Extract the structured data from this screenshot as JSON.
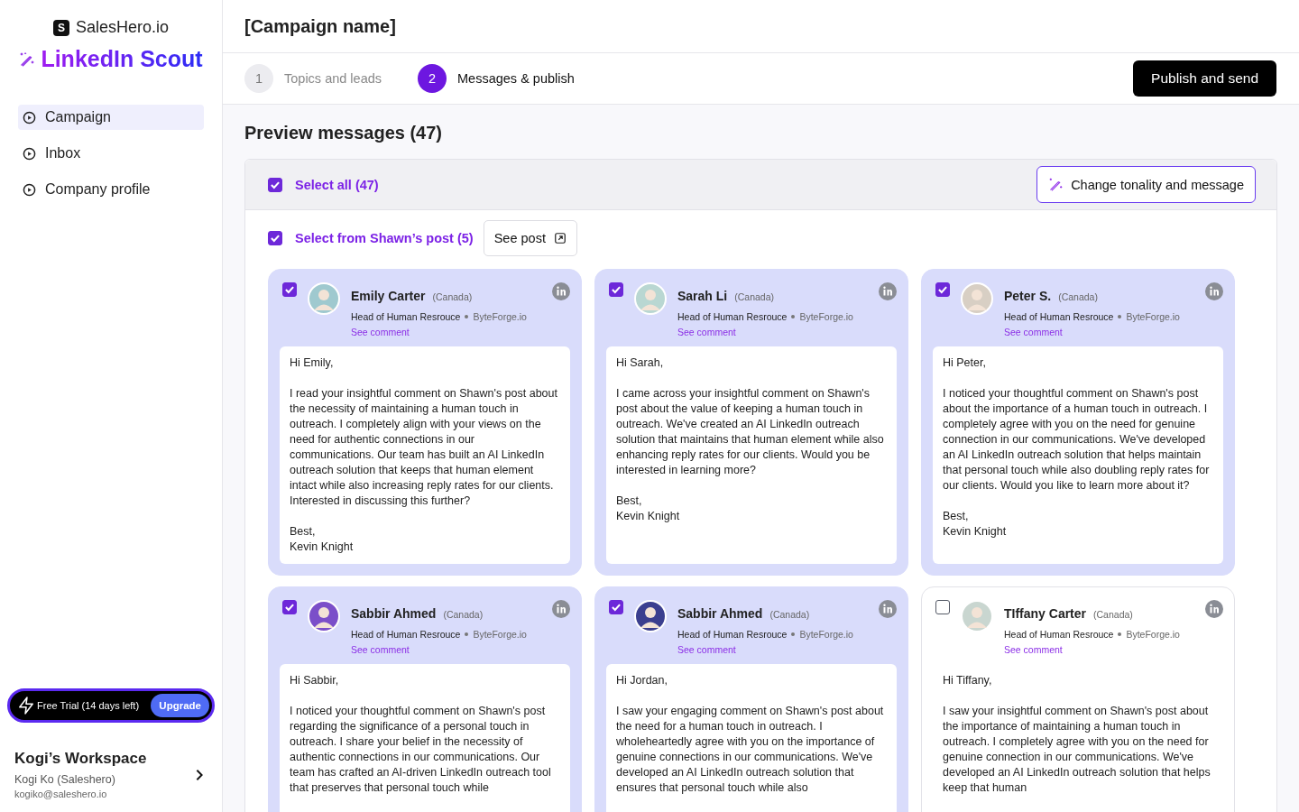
{
  "sidebar": {
    "brand": "SalesHero.io",
    "brand_mark": "S",
    "product": "LinkedIn Scout",
    "items": [
      {
        "label": "Campaign",
        "selected": true
      },
      {
        "label": "Inbox",
        "selected": false
      },
      {
        "label": "Company profile",
        "selected": false
      }
    ],
    "trial": {
      "label": "Free Trial (14 days left)",
      "button": "Upgrade"
    },
    "workspace": {
      "title": "Kogi’s Workspace",
      "user": "Kogi Ko (Saleshero)",
      "email": "kogiko@saleshero.io"
    }
  },
  "header": {
    "title": "[Campaign name]"
  },
  "steps": [
    {
      "number": "1",
      "label": "Topics and leads",
      "selected": false
    },
    {
      "number": "2",
      "label": "Messages & publish",
      "selected": true
    }
  ],
  "publish_button": "Publish and send",
  "preview": {
    "title": "Preview messages (47)",
    "select_all": {
      "label": "Select all (47)",
      "checked": true
    },
    "change_button": "Change tonality and message",
    "select_post": {
      "label": "Select from Shawn’s post (5)",
      "checked": true
    },
    "see_post": "See post",
    "cards": [
      {
        "name": "Emily Carter",
        "country": "(Canada)",
        "role": "Head of Human Resrouce",
        "company": "ByteForge.io",
        "link": "See comment",
        "checked": true,
        "message": "Hi Emily,\n\nI read your insightful comment on Shawn's post about the necessity of maintaining a human touch in outreach. I completely align with your views on the need for authentic connections in our communications. Our team has built an AI LinkedIn outreach solution that keeps that human element intact while also increasing reply rates for our clients. Interested in discussing this further?\n\nBest,\nKevin Knight"
      },
      {
        "name": "Sarah Li",
        "country": "(Canada)",
        "role": "Head of Human Resrouce",
        "company": "ByteForge.io",
        "link": "See comment",
        "checked": true,
        "message": "Hi Sarah,\n\nI came across your insightful comment on Shawn's post about the value of keeping a human touch in outreach. We've created an AI LinkedIn outreach solution that maintains that human element while also enhancing reply rates for our clients. Would you be interested in learning more?\n\nBest,\nKevin Knight"
      },
      {
        "name": "Peter S.",
        "country": "(Canada)",
        "role": "Head of Human Resrouce",
        "company": "ByteForge.io",
        "link": "See comment",
        "checked": true,
        "message": "Hi Peter,\n\nI noticed your thoughtful comment on Shawn's post about the importance of a human touch in outreach. I completely agree with you on the need for genuine connection in our communications. We've developed an AI LinkedIn outreach solution that helps maintain that personal touch while also doubling reply rates for our clients. Would you like to learn more about it?\n\nBest,\nKevin Knight"
      },
      {
        "name": "Sabbir Ahmed",
        "country": "(Canada)",
        "role": "Head of Human Resrouce",
        "company": "ByteForge.io",
        "link": "See comment",
        "checked": true,
        "message": "Hi Sabbir,\n\nI noticed your thoughtful comment on Shawn's post regarding the significance of a personal touch in outreach. I share your belief in the necessity of authentic connections in our communications. Our team has crafted an AI-driven LinkedIn outreach tool that preserves that personal touch while"
      },
      {
        "name": "Sabbir Ahmed",
        "country": "(Canada)",
        "role": "Head of Human Resrouce",
        "company": "ByteForge.io",
        "link": "See comment",
        "checked": true,
        "message": "Hi Jordan,\n\nI saw your engaging comment on Shawn's post about the need for a human touch in outreach. I wholeheartedly agree with you on the importance of genuine connections in our communications. We've developed an AI LinkedIn outreach solution that ensures that personal touch while also"
      },
      {
        "name": "TIffany Carter",
        "country": "(Canada)",
        "role": "Head of Human Resrouce",
        "company": "ByteForge.io",
        "link": "See comment",
        "checked": false,
        "message": "Hi Tiffany,\n\nI saw your insightful comment on Shawn's post about the importance of maintaining a human touch in outreach. I completely agree with you on the need for genuine connection in our communications. We've developed an AI LinkedIn outreach solution that helps keep that human"
      }
    ]
  }
}
